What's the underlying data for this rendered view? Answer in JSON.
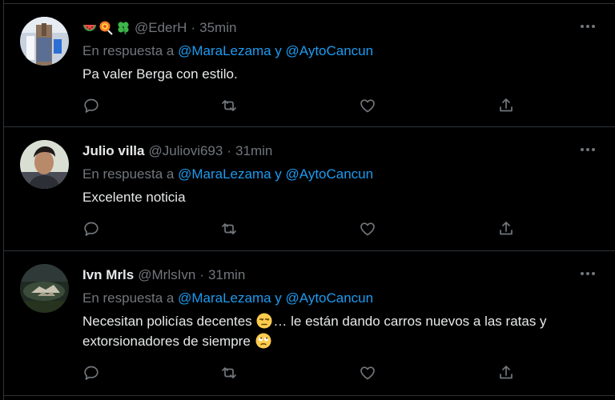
{
  "reply_prefix": "En respuesta a",
  "reply_join": "y",
  "colors": {
    "background": "#000000",
    "text": "#e7e9ea",
    "muted": "#71767b",
    "link": "#1d9bf0",
    "divider": "#2f3336"
  },
  "tweets": [
    {
      "name": "",
      "name_emojis": [
        "watermelon-emoji",
        "lollipop-emoji",
        "four-leaf-clover-emoji"
      ],
      "handle": "@EderH",
      "time": "35min",
      "mentions": [
        "@MaraLezama",
        "@AytoCancun"
      ],
      "text": "Pa valer Berga con estilo."
    },
    {
      "name": "Julio villa",
      "handle": "@Juliovi693",
      "time": "31min",
      "mentions": [
        "@MaraLezama",
        "@AytoCancun"
      ],
      "text": "Excelente noticia"
    },
    {
      "name": "Ivn Mrls",
      "handle": "@MrlsIvn",
      "time": "31min",
      "mentions": [
        "@MaraLezama",
        "@AytoCancun"
      ],
      "text_part1": "Necesitan policías decentes",
      "text_part2": "… le están dando carros nuevos a las ratas y extorsionadores de siempre",
      "text_emojis": [
        "unamused-face-emoji",
        "rolling-eyes-emoji"
      ]
    }
  ],
  "action_icons": [
    "reply-icon",
    "retweet-icon",
    "like-icon",
    "share-icon"
  ]
}
